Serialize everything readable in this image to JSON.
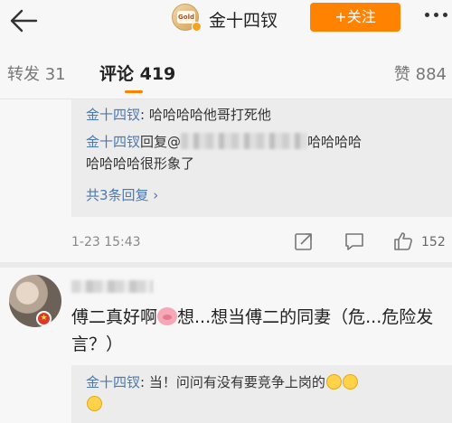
{
  "nav": {
    "avatar_text": "Gold",
    "name": "金十四钗",
    "follow_label": "+关注"
  },
  "tabs": {
    "repost": "转发 31",
    "comment": "评论 419",
    "like": "赞 884"
  },
  "comment1": {
    "replies": [
      {
        "author": "金十四钗",
        "text": ": 哈哈哈哈他哥打死他"
      },
      {
        "author": "金十四钗",
        "text_before": "回复@",
        "text_after": "哈哈哈哈",
        "text_line2": "哈哈哈哈很形象了"
      }
    ],
    "more_replies": "共3条回复 ›",
    "time": "1-23 15:43",
    "likes": "152"
  },
  "comment2": {
    "text_before": "傅二真好啊",
    "text_after": "想...想当傅二的同妻（危...危险发言？）",
    "reply_author": "金十四钗",
    "reply_text": ": 当！问问有没有要竞争上岗的"
  },
  "icons": {
    "back": "back-arrow-icon",
    "share": "share-icon",
    "comment": "comment-icon",
    "like": "thumbs-up-icon"
  },
  "colors": {
    "accent": "#ff8200",
    "link": "#4a78b0"
  }
}
